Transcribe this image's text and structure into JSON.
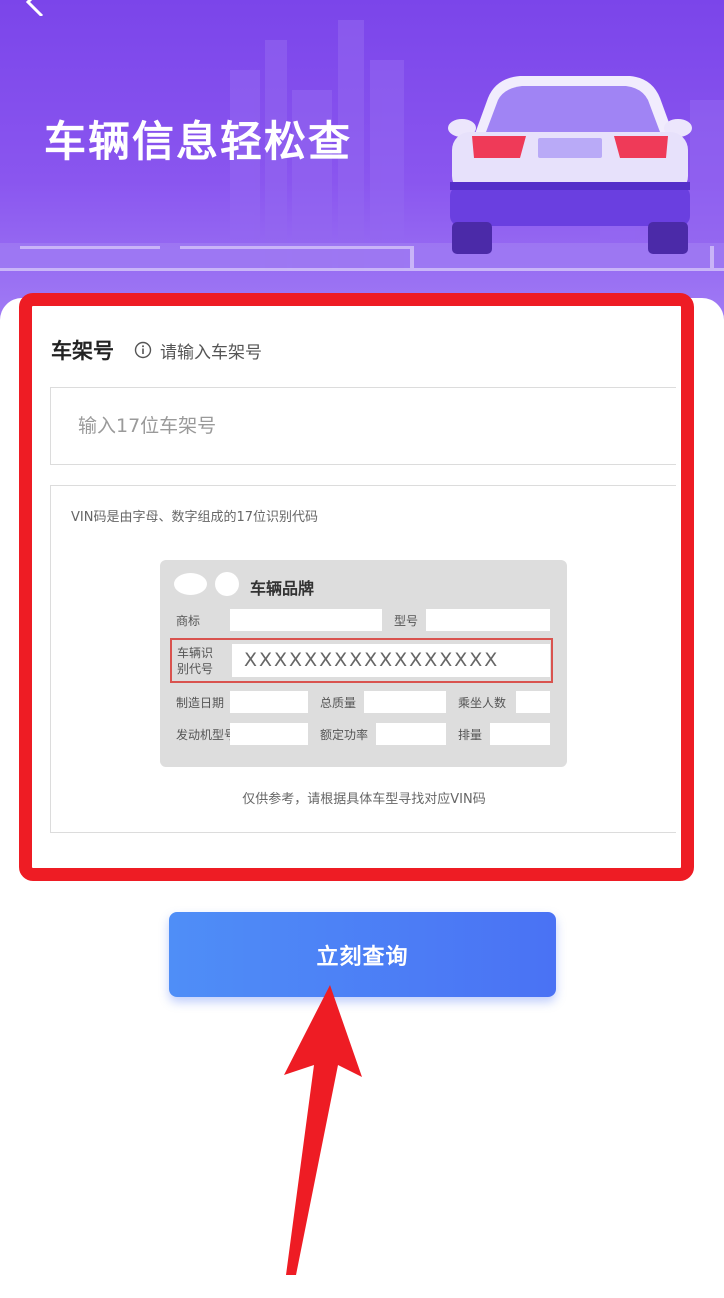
{
  "hero": {
    "title": "车辆信息轻松查"
  },
  "section": {
    "title": "车架号",
    "hint": "请输入车架号"
  },
  "vin_input": {
    "placeholder": "输入17位车架号",
    "value": ""
  },
  "example": {
    "description": "VIN码是由字母、数字组成的17位识别代码",
    "license": {
      "brand_title": "车辆品牌",
      "labels": {
        "trademark": "商标",
        "model": "型号",
        "vin_line1": "车辆识",
        "vin_line2": "别代号",
        "manufacture_date": "制造日期",
        "total_mass": "总质量",
        "passengers": "乘坐人数",
        "engine_model": "发动机型号",
        "rated_power": "额定功率",
        "displacement": "排量"
      },
      "vin_sample": "XXXXXXXXXXXXXXXXX"
    },
    "note": "仅供参考，请根据具体车型寻找对应VIN码"
  },
  "query_button": {
    "label": "立刻查询"
  },
  "colors": {
    "hero": "#7b45ea",
    "button": "#4f8ef7",
    "annotation": "#ee1c24"
  }
}
